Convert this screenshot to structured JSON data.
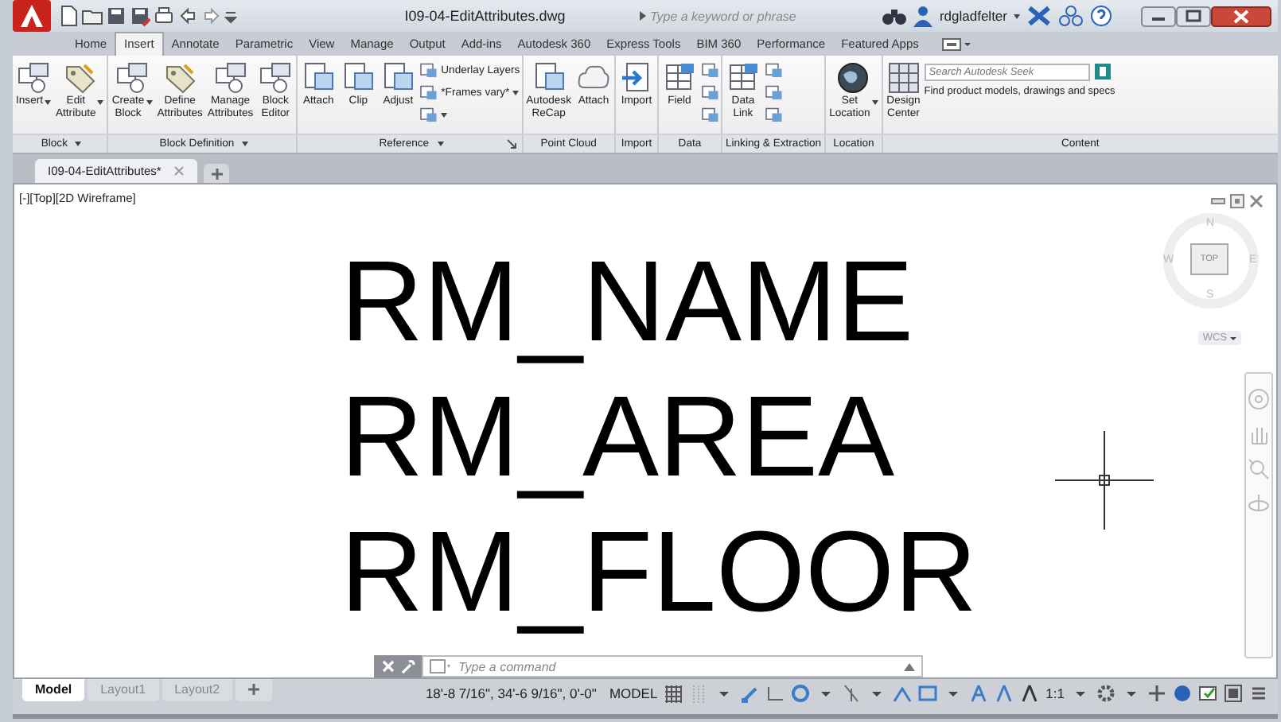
{
  "window": {
    "title": "I09-04-EditAttributes.dwg"
  },
  "search": {
    "placeholder": "Type a keyword or phrase"
  },
  "user": {
    "name": "rdgladfelter"
  },
  "ribbon_tabs": [
    {
      "label": "Home",
      "selected": false
    },
    {
      "label": "Insert",
      "selected": true
    },
    {
      "label": "Annotate",
      "selected": false
    },
    {
      "label": "Parametric",
      "selected": false
    },
    {
      "label": "View",
      "selected": false
    },
    {
      "label": "Manage",
      "selected": false
    },
    {
      "label": "Output",
      "selected": false
    },
    {
      "label": "Add-ins",
      "selected": false
    },
    {
      "label": "Autodesk 360",
      "selected": false
    },
    {
      "label": "Express Tools",
      "selected": false
    },
    {
      "label": "BIM 360",
      "selected": false
    },
    {
      "label": "Performance",
      "selected": false
    },
    {
      "label": "Featured Apps",
      "selected": false
    }
  ],
  "ribbon_panels": [
    {
      "title": "Block",
      "menu": true,
      "launcher": false,
      "items": [
        {
          "kind": "large",
          "label": "Insert",
          "dropdown": true
        },
        {
          "kind": "large",
          "label": "Edit Attribute",
          "dropdown": true
        }
      ]
    },
    {
      "title": "Block Definition",
      "menu": true,
      "launcher": false,
      "items": [
        {
          "kind": "large",
          "label": "Create Block",
          "dropdown": true
        },
        {
          "kind": "large",
          "label": "Define Attributes",
          "dropdown": false
        },
        {
          "kind": "large",
          "label": "Manage Attributes",
          "dropdown": false
        },
        {
          "kind": "large",
          "label": "Block Editor",
          "dropdown": false
        }
      ]
    },
    {
      "title": "Reference",
      "menu": true,
      "launcher": true,
      "items": [
        {
          "kind": "large",
          "label": "Attach",
          "dropdown": false
        },
        {
          "kind": "large",
          "label": "Clip",
          "dropdown": false
        },
        {
          "kind": "large",
          "label": "Adjust",
          "dropdown": false
        },
        {
          "kind": "stack",
          "items": [
            {
              "label": "Underlay Layers",
              "dropdown": false
            },
            {
              "label": "*Frames vary*",
              "dropdown": true
            },
            {
              "dropdown": true
            }
          ]
        }
      ]
    },
    {
      "title": "Point Cloud",
      "menu": false,
      "launcher": false,
      "items": [
        {
          "kind": "large",
          "label": "Autodesk ReCap",
          "dropdown": false
        },
        {
          "kind": "large",
          "label": "Attach",
          "dropdown": false
        }
      ]
    },
    {
      "title": "Import",
      "menu": false,
      "launcher": false,
      "items": [
        {
          "kind": "large",
          "label": "Import",
          "dropdown": false
        }
      ]
    },
    {
      "title": "Data",
      "menu": false,
      "launcher": false,
      "items": [
        {
          "kind": "large",
          "label": "Field",
          "dropdown": false
        },
        {
          "kind": "stack",
          "items": [
            {
              "dropdown": false
            },
            {
              "dropdown": false
            },
            {
              "dropdown": false
            }
          ]
        }
      ]
    },
    {
      "title": "Linking & Extraction",
      "menu": false,
      "launcher": false,
      "items": [
        {
          "kind": "large",
          "label": "Data Link",
          "dropdown": false
        },
        {
          "kind": "stack",
          "items": [
            {
              "dropdown": false
            },
            {
              "dropdown": false
            },
            {
              "dropdown": false
            }
          ]
        }
      ]
    },
    {
      "title": "Location",
      "menu": false,
      "launcher": false,
      "items": [
        {
          "kind": "large",
          "label": "Set Location",
          "dropdown": true
        }
      ]
    },
    {
      "title": "Content",
      "menu": false,
      "launcher": false,
      "items": [
        {
          "kind": "large",
          "label": "Design Center",
          "dropdown": false
        },
        {
          "kind": "seek",
          "placeholder": "Search Autodesk Seek",
          "caption": "Find product models, drawings and specs"
        }
      ]
    }
  ],
  "document_tabs": [
    {
      "label": "I09-04-EditAttributes*",
      "selected": true
    }
  ],
  "viewport": {
    "label": "[-][Top][2D Wireframe]",
    "drawing_texts": [
      "RM_NAME",
      "RM_AREA",
      "RM_FLOOR"
    ],
    "viewcube": {
      "north": "N",
      "west": "W",
      "east": "E",
      "south": "S",
      "face": "TOP",
      "ucs": "WCS"
    }
  },
  "command_line": {
    "placeholder": "Type a command"
  },
  "layout_tabs": [
    {
      "label": "Model",
      "selected": true
    },
    {
      "label": "Layout1",
      "selected": false
    },
    {
      "label": "Layout2",
      "selected": false
    }
  ],
  "status_bar": {
    "coordinates": "18'-8 7/16\", 34'-6 9/16\", 0'-0\"",
    "space": "MODEL",
    "scale": "1:1"
  }
}
